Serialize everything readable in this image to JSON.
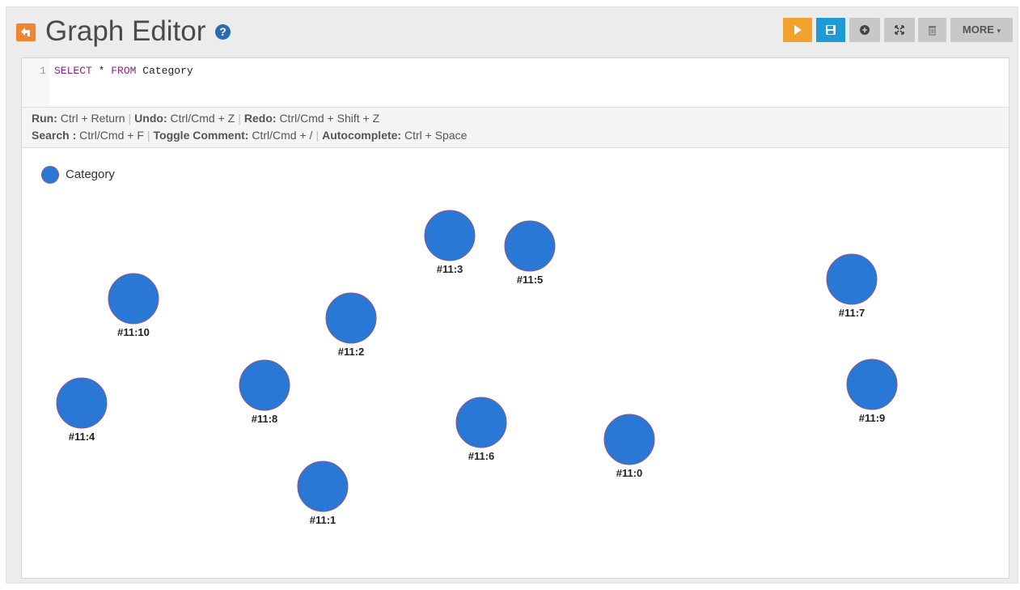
{
  "header": {
    "title": "Graph Editor",
    "help": "?",
    "more_label": "MORE"
  },
  "editor": {
    "line_number": "1",
    "keyword_select": "SELECT",
    "star": "*",
    "keyword_from": "FROM",
    "class_name": "Category"
  },
  "hints": {
    "run_key": "Run:",
    "run_val": "Ctrl + Return",
    "undo_key": "Undo:",
    "undo_val": "Ctrl/Cmd + Z",
    "redo_key": "Redo:",
    "redo_val": "Ctrl/Cmd + Shift + Z",
    "search_key": "Search :",
    "search_val": "Ctrl/Cmd + F",
    "comment_key": "Toggle Comment:",
    "comment_val": "Ctrl/Cmd + /",
    "auto_key": "Autocomplete:",
    "auto_val": "Ctrl + Space"
  },
  "legend": {
    "label": "Category",
    "color": "#2a78d6"
  },
  "nodes": [
    {
      "id": "#11:3"
    },
    {
      "id": "#11:5"
    },
    {
      "id": "#11:7"
    },
    {
      "id": "#11:10"
    },
    {
      "id": "#11:2"
    },
    {
      "id": "#11:8"
    },
    {
      "id": "#11:4"
    },
    {
      "id": "#11:9"
    },
    {
      "id": "#11:6"
    },
    {
      "id": "#11:0"
    },
    {
      "id": "#11:1"
    }
  ]
}
